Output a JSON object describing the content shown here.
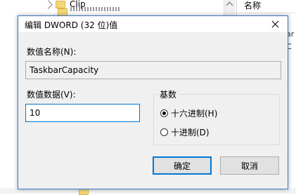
{
  "background": {
    "tree_node_label": "Clip",
    "list_column_header": "名称",
    "list_fragment_1": "ar",
    "list_fragment_2": "C"
  },
  "dialog": {
    "title": "编辑 DWORD (32 位)值",
    "value_name_label": "数值名称(N):",
    "value_name": "TaskbarCapacity",
    "value_data_label": "数值数据(V):",
    "value_data": "10",
    "base_group_label": "基数",
    "base_options": [
      {
        "label": "十六进制(H)",
        "selected": true
      },
      {
        "label": "十进制(D)",
        "selected": false
      }
    ],
    "ok_label": "确定",
    "cancel_label": "取消"
  }
}
